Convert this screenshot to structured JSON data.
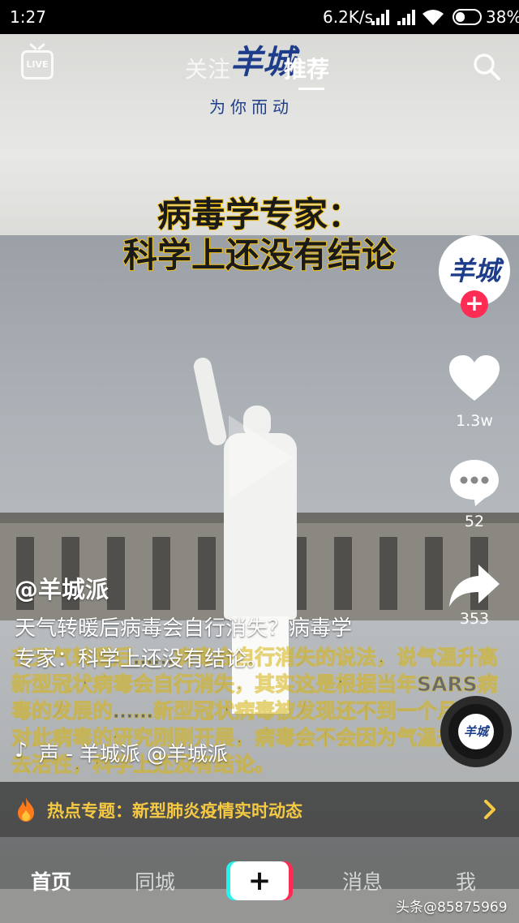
{
  "status_bar": {
    "time": "1:27",
    "network_speed": "6.2K/s",
    "battery_percent": "38%",
    "battery_level": 0.38
  },
  "header": {
    "tab_follow": "关注",
    "tab_recommend": "推荐",
    "live_label": "LIVE",
    "brand_logo": "羊城",
    "brand_slogan": "为你而动"
  },
  "video": {
    "headline_line1": "病毒学专家：",
    "headline_line2": "科学上还没有结论",
    "caption_background": "在天气转暖后……病毒会自行消失的说法，说气温升高新型冠状病毒会自行消失，其实这是根据当年SARS病毒的发展的……新型冠状病毒被发现还不到一个月，针对此病毒的研究刚刚开展，病毒会不会因为气温升高失去活性，科学上还没有结论。"
  },
  "rail": {
    "avatar_text": "羊城",
    "like_count": "1.3w",
    "comment_count": "52",
    "share_count": "353",
    "disc_text": "羊城"
  },
  "post": {
    "author": "@羊城派",
    "description": "天气转暖后病毒会自行消失？病毒学专家：科学上还没有结论。",
    "music": "声 - 羊城派    @羊城派"
  },
  "hot_topic": {
    "text": "热点专题：新型肺炎疫情实时动态"
  },
  "bottom_nav": {
    "home": "首页",
    "nearby": "同城",
    "publish": "+",
    "messages": "消息",
    "me": "我"
  },
  "watermark": "头条@85875969",
  "colors": {
    "accent_red": "#fe2c55",
    "accent_cyan": "#25f4ee",
    "hot_text": "#f6c943",
    "brand_blue": "#1d3c8a"
  }
}
